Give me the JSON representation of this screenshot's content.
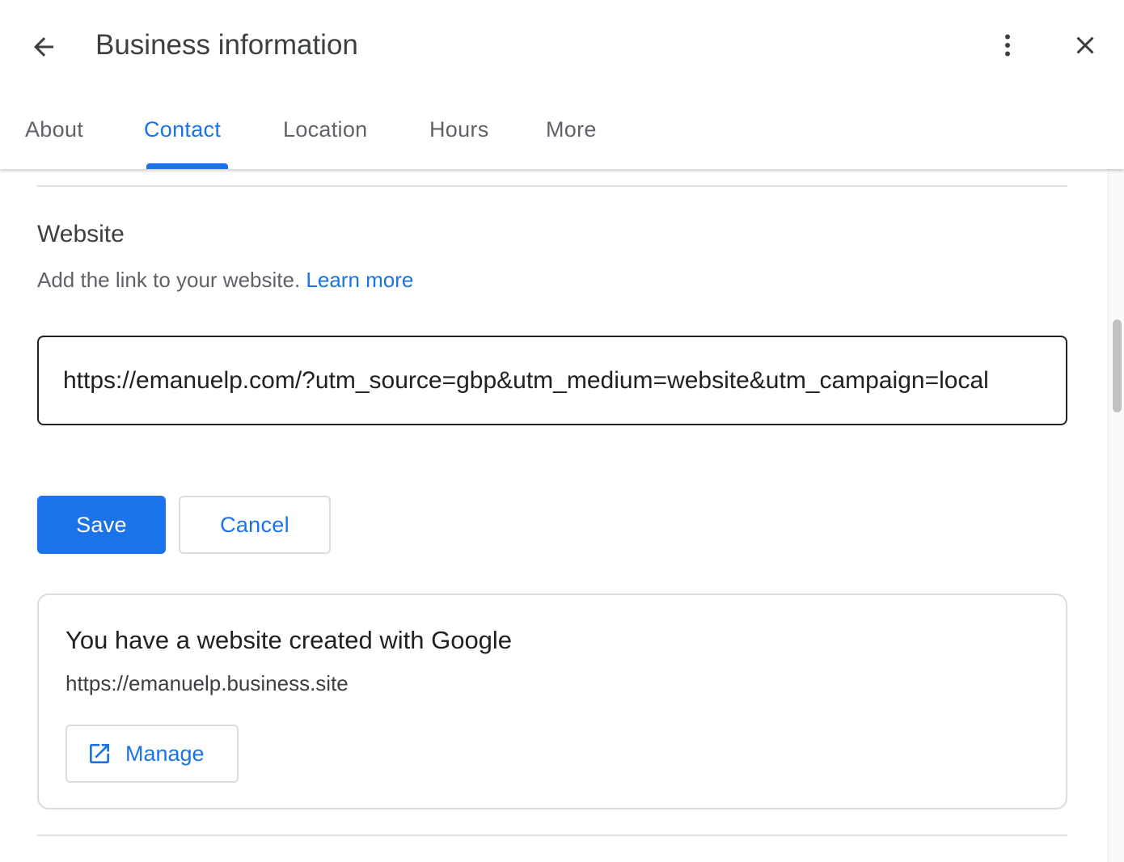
{
  "header": {
    "title": "Business information",
    "back_icon": "arrow-back-icon",
    "more_icon": "more-vert-icon",
    "close_icon": "close-icon"
  },
  "tabs": [
    {
      "label": "About",
      "active": false
    },
    {
      "label": "Contact",
      "active": true
    },
    {
      "label": "Location",
      "active": false
    },
    {
      "label": "Hours",
      "active": false
    },
    {
      "label": "More",
      "active": false
    }
  ],
  "website": {
    "title": "Website",
    "description": "Add the link to your website.",
    "learn_more": "Learn more",
    "url_value": "https://emanuelp.com/?utm_source=gbp&utm_medium=website&utm_campaign=local"
  },
  "actions": {
    "save_label": "Save",
    "cancel_label": "Cancel"
  },
  "google_site": {
    "title": "You have a website created with Google",
    "url": "https://emanuelp.business.site",
    "manage_label": "Manage",
    "manage_icon": "open-in-new-icon"
  },
  "colors": {
    "accent": "#1a73e8",
    "text_primary": "#202124",
    "text_secondary": "#5f6368",
    "border": "#dadce0"
  }
}
